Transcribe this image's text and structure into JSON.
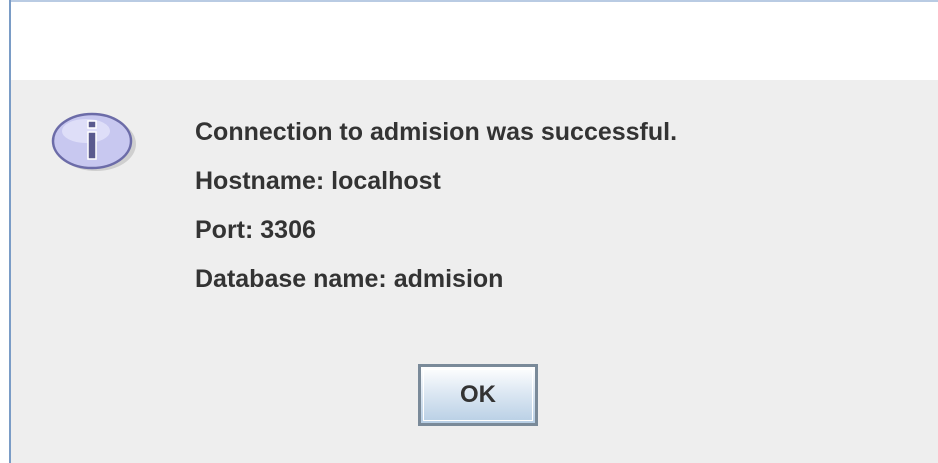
{
  "dialog": {
    "icon": "info-icon",
    "message_lines": [
      "Connection to admision was successful.",
      "Hostname: localhost",
      "Port: 3306",
      "Database name: admision"
    ],
    "ok_label": "OK"
  },
  "colors": {
    "dialog_background": "#eeeeee",
    "title_area": "#ffffff",
    "frame_border": "#7a9cc6",
    "text": "#333333",
    "icon_fill": "#c8c8f0",
    "icon_border": "#6c6ca8"
  }
}
